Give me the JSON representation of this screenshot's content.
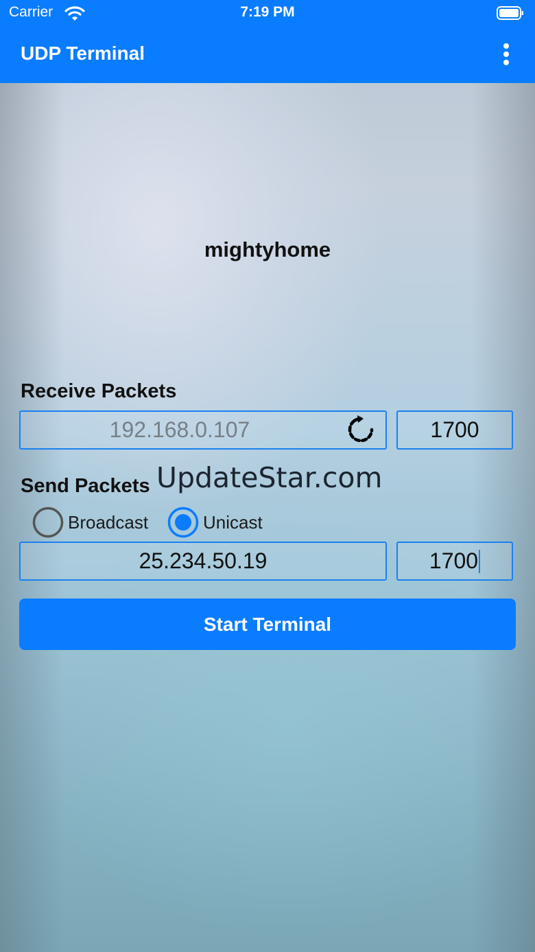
{
  "status_bar": {
    "carrier": "Carrier",
    "time": "7:19 PM"
  },
  "nav": {
    "title": "UDP Terminal",
    "menu_icon": "more-vertical-icon"
  },
  "device_name": "mightyhome",
  "receive": {
    "label": "Receive Packets",
    "ip": "192.168.0.107",
    "port": "1700",
    "refresh_icon": "refresh-icon"
  },
  "watermark": "UpdateStar.com",
  "send": {
    "label": "Send Packets",
    "mode_options": [
      {
        "label": "Broadcast",
        "selected": false
      },
      {
        "label": "Unicast",
        "selected": true
      }
    ],
    "ip": "25.234.50.19",
    "port": "1700"
  },
  "start_button": "Start Terminal",
  "colors": {
    "accent": "#0a7cff",
    "field_border": "#1a80f0",
    "radio_unselected": "#555555"
  }
}
